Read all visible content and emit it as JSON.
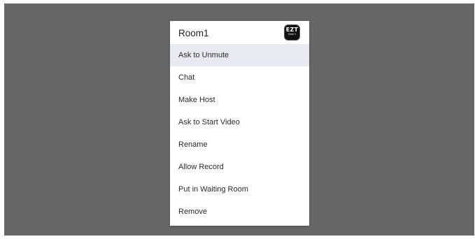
{
  "dialog": {
    "title": "Room1",
    "app_icon": {
      "name": "ezt-app-icon",
      "main_text": "EZT",
      "sub_text": "Gaid 1"
    },
    "items": [
      {
        "label": "Ask to Unmute",
        "highlighted": true
      },
      {
        "label": "Chat",
        "highlighted": false
      },
      {
        "label": "Make Host",
        "highlighted": false
      },
      {
        "label": "Ask to Start Video",
        "highlighted": false
      },
      {
        "label": "Rename",
        "highlighted": false
      },
      {
        "label": "Allow Record",
        "highlighted": false
      },
      {
        "label": "Put in Waiting Room",
        "highlighted": false
      },
      {
        "label": "Remove",
        "highlighted": false
      }
    ]
  },
  "colors": {
    "backdrop": "#666666",
    "panel": "#ffffff",
    "highlight": "#e9e9f1",
    "text": "#2a2a2a"
  }
}
